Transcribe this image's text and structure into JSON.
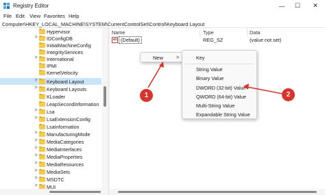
{
  "window": {
    "title": "Registry Editor",
    "minimize_glyph": "—",
    "maximize_glyph": "☐",
    "close_glyph": "✕"
  },
  "menubar": {
    "items": [
      "File",
      "Edit",
      "View",
      "Favorites",
      "Help"
    ]
  },
  "address": {
    "path": "Computer\\HKEY_LOCAL_MACHINE\\SYSTEM\\CurrentControlSet\\Control\\Keyboard Layout"
  },
  "tree": {
    "items": [
      {
        "label": "Hypervisor",
        "expand": ""
      },
      {
        "label": "IDConfigDB",
        "expand": ">"
      },
      {
        "label": "InitialMachineConfig",
        "expand": ""
      },
      {
        "label": "IntegrityServices",
        "expand": ""
      },
      {
        "label": "International",
        "expand": ">"
      },
      {
        "label": "IPMI",
        "expand": ""
      },
      {
        "label": "KernelVelocity",
        "expand": ""
      },
      {
        "label": "Keyboard Layout",
        "expand": ">",
        "selected": true
      },
      {
        "label": "Keyboard Layouts",
        "expand": ">"
      },
      {
        "label": "KLoader",
        "expand": ""
      },
      {
        "label": "LeapSecondInformation",
        "expand": ""
      },
      {
        "label": "Lsa",
        "expand": ">"
      },
      {
        "label": "LsaExtensionConfig",
        "expand": ">"
      },
      {
        "label": "LsaInformation",
        "expand": ""
      },
      {
        "label": "ManufacturingMode",
        "expand": ">"
      },
      {
        "label": "MediaCategories",
        "expand": ">"
      },
      {
        "label": "MediaInterfaces",
        "expand": ">"
      },
      {
        "label": "MediaProperties",
        "expand": ">"
      },
      {
        "label": "MediaResources",
        "expand": ">"
      },
      {
        "label": "MediaSets",
        "expand": ">"
      },
      {
        "label": "MSDTC",
        "expand": ">"
      },
      {
        "label": "MUI",
        "expand": ">"
      }
    ]
  },
  "list": {
    "columns": {
      "name": "Name",
      "type": "Type",
      "data": "Data"
    },
    "rows": [
      {
        "name": "(Default)",
        "type": "REG_SZ",
        "data": "(value not set)",
        "icon": "ab"
      }
    ]
  },
  "context_menu": {
    "new_label": "New",
    "arrow": ">"
  },
  "submenu": {
    "items": [
      "Key",
      "String Value",
      "Binary Value",
      "DWORD (32-bit) Value",
      "QWORD (64-bit) Value",
      "Multi-String Value",
      "Expandable String Value"
    ]
  },
  "callouts": {
    "one": "1",
    "two": "2"
  },
  "colors": {
    "selection": "#cce4f7",
    "callout": "#d9342b",
    "folder": "#f4c94e"
  }
}
